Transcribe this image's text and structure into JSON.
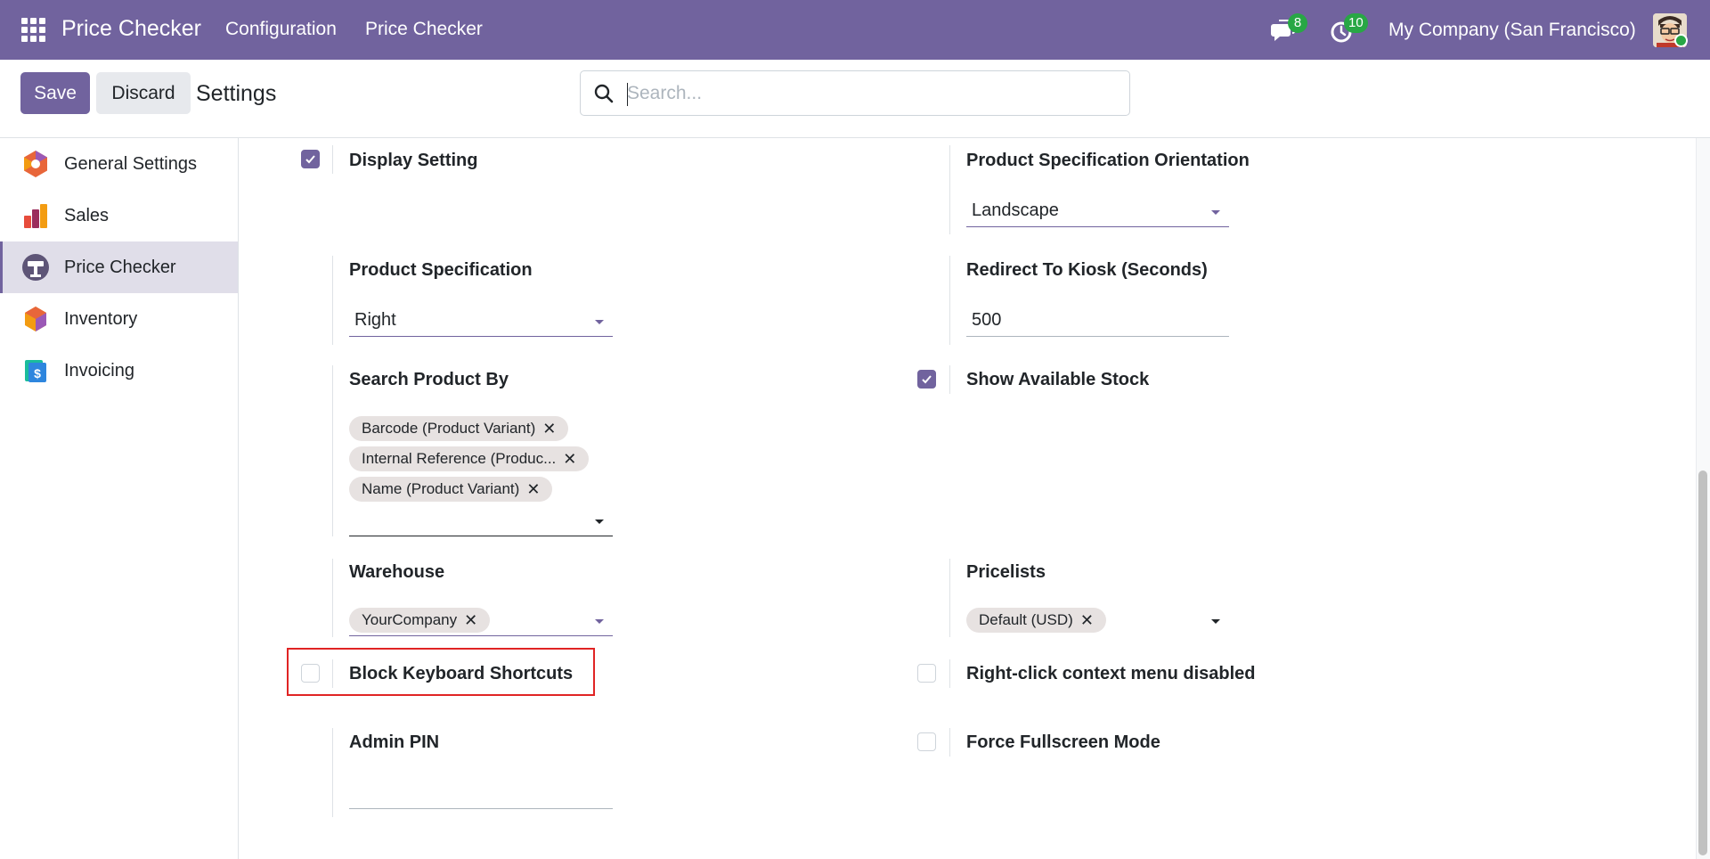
{
  "navbar": {
    "brand": "Price Checker",
    "menu": [
      "Configuration",
      "Price Checker"
    ],
    "chat_count": "8",
    "activity_count": "10",
    "company": "My Company (San Francisco)"
  },
  "control": {
    "save_label": "Save",
    "discard_label": "Discard",
    "title": "Settings",
    "search_placeholder": "Search..."
  },
  "sidebar": {
    "items": [
      {
        "label": "General Settings",
        "icon": "general-settings-icon"
      },
      {
        "label": "Sales",
        "icon": "sales-icon"
      },
      {
        "label": "Price Checker",
        "icon": "price-checker-icon",
        "active": true
      },
      {
        "label": "Inventory",
        "icon": "inventory-icon"
      },
      {
        "label": "Invoicing",
        "icon": "invoicing-icon"
      }
    ]
  },
  "settings": {
    "display_setting": {
      "label": "Display Setting",
      "checked": true
    },
    "product_spec_orientation": {
      "label": "Product Specification Orientation",
      "value": "Landscape"
    },
    "product_spec": {
      "label": "Product Specification",
      "value": "Right"
    },
    "redirect_kiosk": {
      "label": "Redirect To Kiosk (Seconds)",
      "value": "500"
    },
    "search_product_by": {
      "label": "Search Product By",
      "tags": [
        "Barcode (Product Variant)",
        "Internal Reference (Produc...",
        "Name (Product Variant)"
      ]
    },
    "show_stock": {
      "label": "Show Available Stock",
      "checked": true
    },
    "warehouse": {
      "label": "Warehouse",
      "tags": [
        "YourCompany"
      ]
    },
    "pricelists": {
      "label": "Pricelists",
      "tags": [
        "Default (USD)"
      ]
    },
    "block_shortcuts": {
      "label": "Block Keyboard Shortcuts",
      "checked": false
    },
    "right_click": {
      "label": "Right-click context menu disabled",
      "checked": false
    },
    "admin_pin": {
      "label": "Admin PIN",
      "value": ""
    },
    "force_fullscreen": {
      "label": "Force Fullscreen Mode",
      "checked": false
    }
  },
  "colors": {
    "brand": "#71639e",
    "badge": "#28a745",
    "highlight": "#e02424"
  }
}
